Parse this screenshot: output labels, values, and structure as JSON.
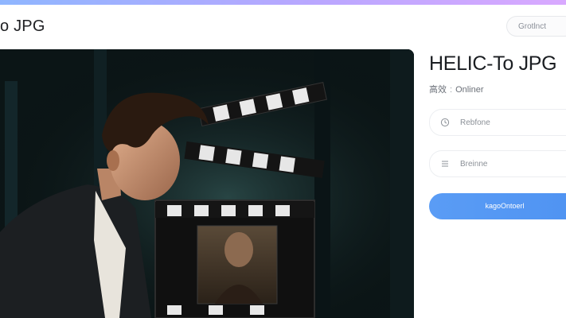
{
  "header": {
    "title": "o JPG",
    "top_button_label": "Grotlnct"
  },
  "panel": {
    "title": "HELIC-To JPG",
    "subtitle_prefix": "高效",
    "subtitle_sep": ":",
    "subtitle_suffix": "Onliner",
    "fields": [
      {
        "icon": "clock-icon",
        "value": "Rebfone"
      },
      {
        "icon": "list-icon",
        "value": "Breinne"
      }
    ],
    "convert_label": "kagoOntoerl"
  },
  "colors": {
    "accent": "#5a9cf5",
    "bar_start": "#8fb6ff",
    "bar_end": "#d9a9ff"
  }
}
